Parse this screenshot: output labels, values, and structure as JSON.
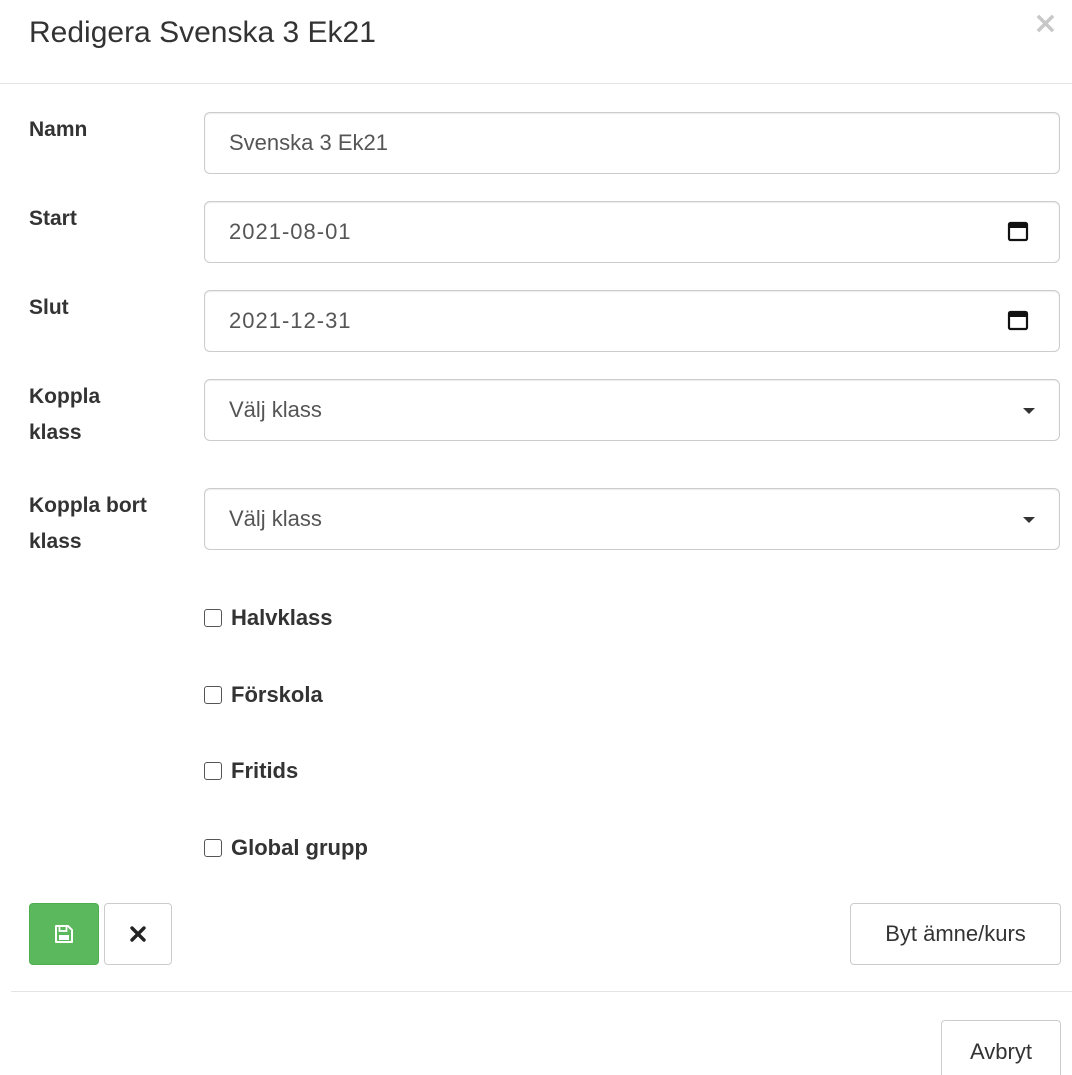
{
  "header": {
    "title": "Redigera Svenska 3 Ek21",
    "close_symbol": "×"
  },
  "form": {
    "name": {
      "label": "Namn",
      "value": "Svenska 3 Ek21"
    },
    "start": {
      "label": "Start",
      "value": "2021-08-01",
      "icon": "calendar-icon"
    },
    "end": {
      "label": "Slut",
      "value": "2021-12-31",
      "icon": "calendar-icon"
    },
    "link_class": {
      "label": "Koppla klass",
      "value": "Välj klass",
      "icon": "caret-down-icon"
    },
    "unlink_class": {
      "label": "Koppla bort klass",
      "value": "Välj klass",
      "icon": "caret-down-icon"
    },
    "checkboxes": [
      {
        "label": "Halvklass",
        "checked": false
      },
      {
        "label": "Förskola",
        "checked": false
      },
      {
        "label": "Fritids",
        "checked": false
      },
      {
        "label": "Global grupp",
        "checked": false
      }
    ]
  },
  "actions": {
    "save_icon": "floppy-disk-icon",
    "cancel_icon": "close-icon",
    "change_subject_label": "Byt ämne/kurs",
    "abort_label": "Avbryt"
  },
  "colors": {
    "save_button": "#5cb85c",
    "border": "#cccccc",
    "close": "#c8c8c8"
  }
}
